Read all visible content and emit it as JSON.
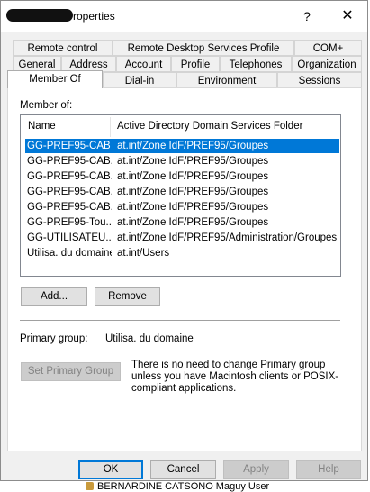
{
  "background": {
    "bottom_text": "BERNARDINE CATSONO Maguy   User"
  },
  "window": {
    "title_suffix": "roperties",
    "help_glyph": "?",
    "close_glyph": "✕"
  },
  "tabs": {
    "row1": [
      "Remote control",
      "Remote Desktop Services Profile",
      "COM+"
    ],
    "row2": [
      "General",
      "Address",
      "Account",
      "Profile",
      "Telephones",
      "Organization"
    ],
    "row3": [
      "Member Of",
      "Dial-in",
      "Environment",
      "Sessions"
    ],
    "active": "Member Of"
  },
  "member_of": {
    "label": "Member of:",
    "columns": [
      "Name",
      "Active Directory Domain Services Folder"
    ],
    "rows": [
      {
        "name": "GG-PREF95-CAB",
        "folder": "at.int/Zone IdF/PREF95/Groupes",
        "selected": true
      },
      {
        "name": "GG-PREF95-CAB...",
        "folder": "at.int/Zone IdF/PREF95/Groupes",
        "selected": false
      },
      {
        "name": "GG-PREF95-CAB...",
        "folder": "at.int/Zone IdF/PREF95/Groupes",
        "selected": false
      },
      {
        "name": "GG-PREF95-CAB...",
        "folder": "at.int/Zone IdF/PREF95/Groupes",
        "selected": false
      },
      {
        "name": "GG-PREF95-CAB...",
        "folder": "at.int/Zone IdF/PREF95/Groupes",
        "selected": false
      },
      {
        "name": "GG-PREF95-Tou...",
        "folder": "at.int/Zone IdF/PREF95/Groupes",
        "selected": false
      },
      {
        "name": "GG-UTILISATEU...",
        "folder": "at.int/Zone IdF/PREF95/Administration/Groupes...",
        "selected": false
      },
      {
        "name": "Utilisa. du domaine",
        "folder": "at.int/Users",
        "selected": false
      }
    ],
    "add_label": "Add...",
    "remove_label": "Remove"
  },
  "primary_group": {
    "label": "Primary group:",
    "value": "Utilisa. du domaine",
    "set_label": "Set Primary Group",
    "note": "There is no need to change Primary group unless you have Macintosh clients or POSIX-compliant applications."
  },
  "footer": {
    "ok": "OK",
    "cancel": "Cancel",
    "apply": "Apply",
    "help": "Help"
  },
  "colors": {
    "selection": "#0078d7",
    "dialog_bg": "#f0f0f0"
  }
}
